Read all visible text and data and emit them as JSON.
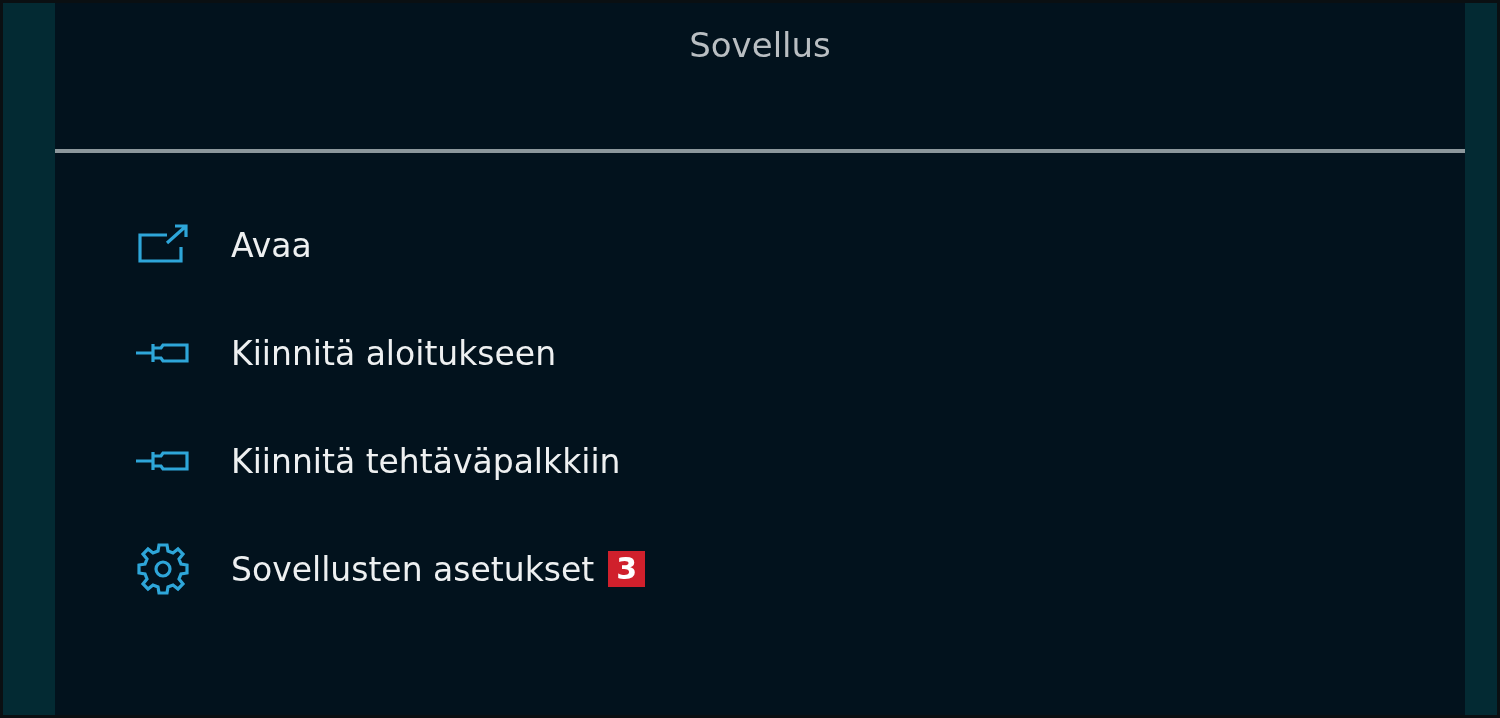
{
  "header": {
    "title": "Sovellus"
  },
  "menu_items": [
    {
      "kind": "open",
      "label": "Avaa"
    },
    {
      "kind": "pin",
      "label": "Kiinnitä aloitukseen"
    },
    {
      "kind": "pin",
      "label": "Kiinnitä tehtäväpalkkiin"
    },
    {
      "kind": "settings",
      "label": "Sovellusten asetukset",
      "badge": "3"
    }
  ]
}
